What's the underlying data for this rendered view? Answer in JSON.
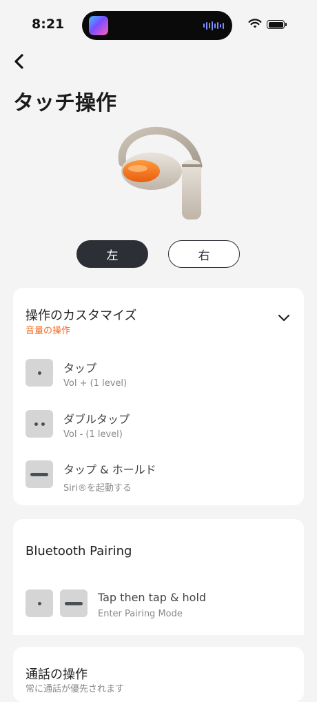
{
  "status_bar": {
    "time": "8:21",
    "island_app_icon": "music-app-icon",
    "icons": [
      "wifi-icon",
      "battery-icon"
    ]
  },
  "nav": {
    "back_icon": "chevron-left-icon"
  },
  "page": {
    "title": "タッチ操作",
    "product_image": "earbud-image"
  },
  "side_selector": {
    "left_label": "左",
    "right_label": "右",
    "selected": "left"
  },
  "controls_card": {
    "title": "操作のカスタマイズ",
    "subtitle": "音量の操作",
    "expand_icon": "chevron-down-icon",
    "gestures": [
      {
        "icon": "single-tap-icon",
        "name": "タップ",
        "action": "Vol + (1 level)"
      },
      {
        "icon": "double-tap-icon",
        "name": "ダブルタップ",
        "action": "Vol - (1 level)"
      },
      {
        "icon": "tap-hold-icon",
        "name": "タップ & ホールド",
        "action": "Siri®を起動する"
      }
    ]
  },
  "pairing_card": {
    "title": "Bluetooth Pairing",
    "gesture_name": "Tap then tap & hold",
    "gesture_action": "Enter Pairing Mode"
  },
  "call_card": {
    "title": "通話の操作",
    "subtitle": "常に通話が優先されます"
  },
  "colors": {
    "background": "#f4f4f4",
    "accent": "#f26a21",
    "selected_toggle": "#2c2f36",
    "card": "#ffffff"
  }
}
